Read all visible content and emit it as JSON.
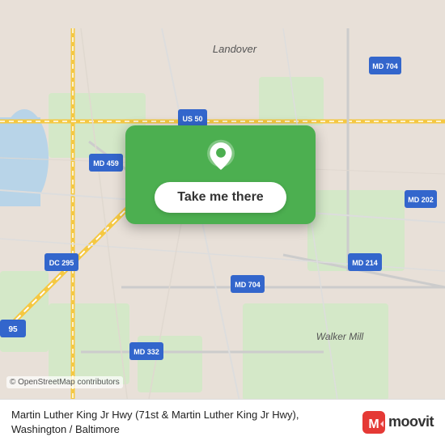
{
  "map": {
    "attribution": "© OpenStreetMap contributors"
  },
  "card": {
    "button_label": "Take me there"
  },
  "bottom": {
    "location_text": "Martin Luther King Jr Hwy (71st & Martin Luther King Jr Hwy), Washington / Baltimore",
    "moovit_label": "moovit"
  }
}
